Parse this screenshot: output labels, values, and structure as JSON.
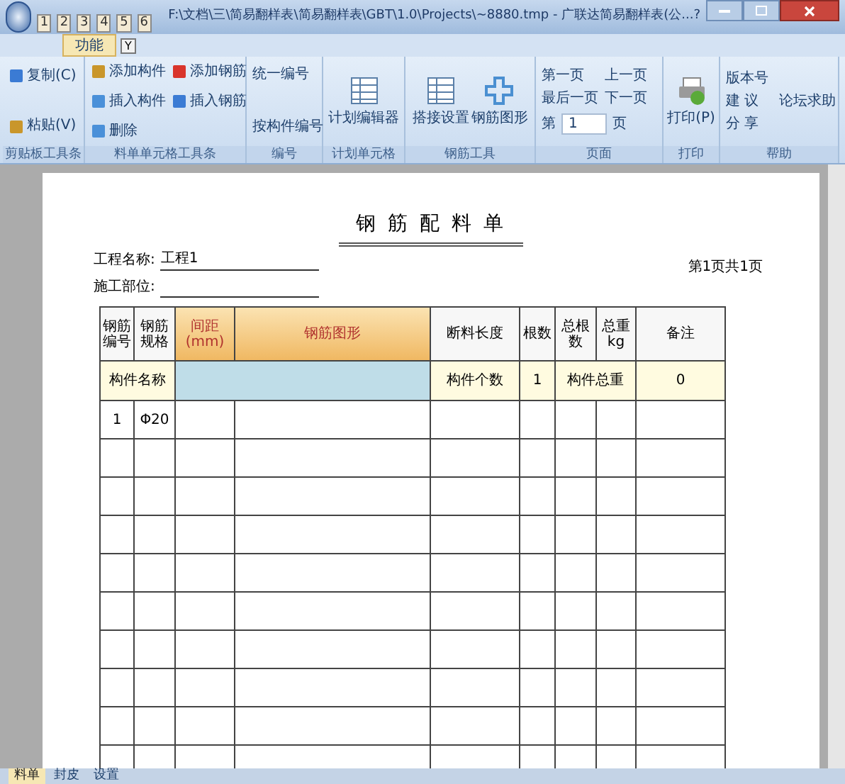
{
  "window": {
    "title": "F:\\文档\\三\\简易翻样表\\简易翻样表\\GBT\\1.0\\Projects\\~8880.tmp - 广联达简易翻样表(公...?",
    "quick_access": [
      "1",
      "2",
      "3",
      "4",
      "5",
      "6"
    ]
  },
  "tabs": [
    {
      "label": "功能",
      "selected": true,
      "key_tip": "Y"
    }
  ],
  "ribbon_groups": [
    {
      "label": "剪贴板工具条",
      "items": [
        {
          "kind": "small",
          "label": "复制(C)"
        },
        {
          "kind": "small",
          "label": "粘贴(V)"
        }
      ]
    },
    {
      "label": "料单单元格工具条",
      "items": [
        {
          "kind": "small",
          "label": "添加构件"
        },
        {
          "kind": "small",
          "label": "插入构件"
        },
        {
          "kind": "small",
          "label": "删除"
        },
        {
          "kind": "small",
          "label": "添加钢筋"
        },
        {
          "kind": "small",
          "label": "插入钢筋"
        }
      ]
    },
    {
      "label": "编号",
      "items": [
        {
          "kind": "text",
          "label": "统一编号"
        },
        {
          "kind": "text",
          "label": "按构件编号"
        }
      ]
    },
    {
      "label": "计划单元格",
      "items": [
        {
          "kind": "large",
          "label": "计划编辑器"
        }
      ]
    },
    {
      "label": "钢筋工具",
      "items": [
        {
          "kind": "large",
          "label": "搭接设置"
        },
        {
          "kind": "large",
          "label": "钢筋图形"
        }
      ]
    },
    {
      "label": "页面",
      "items": [
        {
          "kind": "text",
          "label": "第一页"
        },
        {
          "kind": "text",
          "label": "上一页"
        },
        {
          "kind": "text",
          "label": "最后一页"
        },
        {
          "kind": "text",
          "label": "下一页"
        },
        {
          "kind": "page_field",
          "prefix": "第",
          "value": "1",
          "suffix": "页"
        }
      ]
    },
    {
      "label": "打印",
      "items": [
        {
          "kind": "large",
          "label": "打印(P)"
        }
      ]
    },
    {
      "label": "帮助",
      "items": [
        {
          "kind": "text",
          "label": "版本号"
        },
        {
          "kind": "text",
          "label": "建 议"
        },
        {
          "kind": "text",
          "label": "论坛求助"
        },
        {
          "kind": "text",
          "label": "分 享"
        }
      ]
    }
  ],
  "sheet": {
    "title": "钢 筋 配 料 单",
    "fields": [
      {
        "label": "工程名称:",
        "value": "工程1"
      },
      {
        "label": "施工部位:"
      }
    ],
    "page_info": "第1页共1页",
    "columns": [
      "钢筋编号",
      "钢筋规格",
      "间距(mm)",
      "钢筋图形",
      "断料长度",
      "根数",
      "总根数",
      "总重kg",
      "备注"
    ],
    "summary": {
      "name_label": "构件名称",
      "count_label": "构件个数",
      "count": "1",
      "weight_label": "构件总重",
      "weight": "0"
    },
    "rows": [
      {
        "no": "1",
        "spec": "Φ20"
      }
    ]
  },
  "bottom_tabs": [
    {
      "label": "料单",
      "selected": true
    },
    {
      "label": "封皮",
      "selected": false
    },
    {
      "label": "设置",
      "selected": false
    }
  ]
}
